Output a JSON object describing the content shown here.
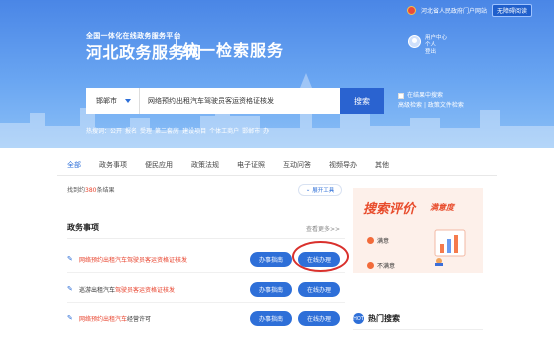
{
  "topbar": {
    "gov_link": "河北省人民政府门户网站",
    "accessible": "无障碍阅读"
  },
  "brand": {
    "subtitle": "全国一体化在线政务服务平台",
    "name": "河北政务服务网",
    "title": "统一检索服务"
  },
  "user": {
    "line1": "用户中心",
    "line2": "个人",
    "line3": "登出"
  },
  "search": {
    "city": "邯郸市",
    "query": "网络预约出租汽车驾驶员客运资格证核发",
    "button": "搜索",
    "in_results": "在结果中搜索",
    "advanced": "高级检索",
    "policy": "政策文件检索"
  },
  "hot_words": [
    "热搜词：公开",
    "报名",
    "受理",
    "第二套房",
    "建设项目",
    "个体工商户",
    "邯郸市",
    "办"
  ],
  "tabs": [
    "全部",
    "政务事项",
    "便民应用",
    "政策法规",
    "电子证照",
    "互动问答",
    "视频导办",
    "其他"
  ],
  "results": {
    "prefix": "找到约",
    "count": "380",
    "suffix": "条结果",
    "expand": "展开工具"
  },
  "section": {
    "title": "政务事项",
    "more": "查看更多>>"
  },
  "rows": [
    {
      "pre": "",
      "hl": "网络预约出租汽车驾驶员客运资格证核发",
      "post": "",
      "guide": "办事指南",
      "online": "在线办理"
    },
    {
      "pre": "巡游出租汽车",
      "hl": "驾驶员客运资格证核发",
      "post": "",
      "guide": "办事指南",
      "online": "在线办理"
    },
    {
      "pre": "",
      "hl": "网络预约出租汽车",
      "post": "经营许可",
      "guide": "办事指南",
      "online": "在线办理"
    }
  ],
  "eval": {
    "title": "搜索评价",
    "title_b": "满意度",
    "opt1": "满意",
    "opt2": "不满意"
  },
  "hot_search": {
    "icon": "HOT",
    "label": "热门搜索"
  },
  "colors": {
    "primary": "#2e6fd8",
    "highlight": "#e8432d",
    "annotation": "#d9302c"
  }
}
